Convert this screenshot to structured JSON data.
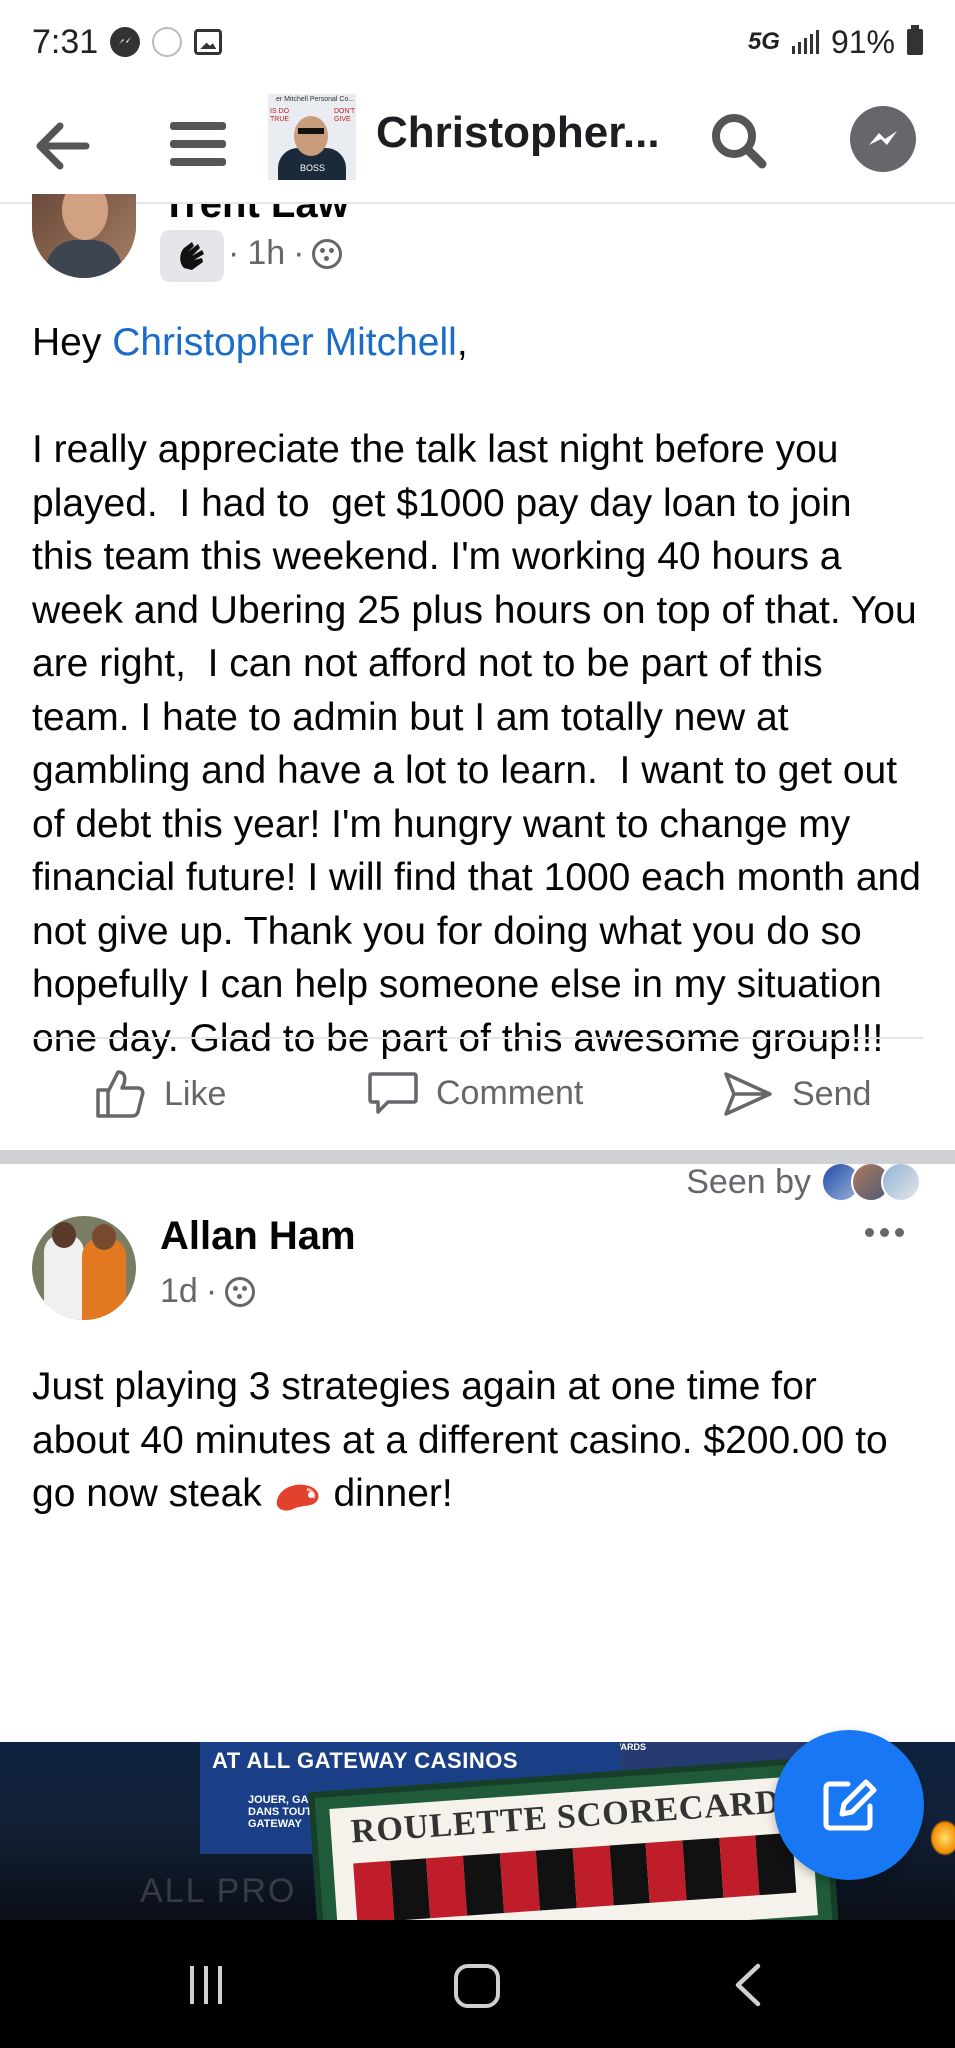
{
  "status_bar": {
    "time": "7:31",
    "network": "5G",
    "battery": "91%"
  },
  "header": {
    "group_name": "Christopher...",
    "thumb_caption_top": "er Mitchell Personal Co...",
    "thumb_left": "IS DO\nTRUE",
    "thumb_right": "DON'T\nGIVE",
    "thumb_shirt": "BOSS"
  },
  "post1": {
    "author_partial": "Trent Law",
    "time": "1h",
    "greeting_prefix": "Hey ",
    "mention": "Christopher Mitchell",
    "greeting_suffix": ",",
    "body": "I really appreciate the talk last night before you played.  I had to  get $1000 pay day loan to join this team this weekend. I'm working 40 hours a week and Ubering 25 plus hours on top of that. You are right,  I can not afford not to be part of this team. I hate to admin but I am totally new at gambling and have a lot to learn.  I want to get out of debt this year! I'm hungry want to change my financial future! I will find that 1000 each month and not give up. Thank you for doing what you do so hopefully I can help someone else in my situation one day. Glad to be part of this awesome group!!!",
    "seen_by_label": "Seen by",
    "actions": {
      "like": "Like",
      "comment": "Comment",
      "send": "Send"
    }
  },
  "post2": {
    "author": "Allan Ham",
    "time": "1d",
    "body_before_emoji": "Just playing 3 strategies again at one time for about 40 minutes at a different casino. $200.00 to go now steak ",
    "body_after_emoji": " dinner!",
    "photo": {
      "sign_text": "AT ALL GATEWAY CASINOS",
      "sign_subtext": "JOUER, GAGNER ET RÉCLAMER\nDANS TOUTES LES\nGATEWAY",
      "rewards_text": "REWARDS",
      "board_title": "ROULETTE SCORECARD",
      "background_text": "ALL PRO"
    }
  },
  "colors": {
    "accent": "#1877f2",
    "mention": "#1b6bc9",
    "secondary_text": "#65676b",
    "divider": "#e4e6eb",
    "separator": "#cfd1d5"
  },
  "icons": {
    "back": "arrow-left-icon",
    "menu": "hamburger-icon",
    "search": "search-icon",
    "messenger": "messenger-icon",
    "like": "thumbs-up-icon",
    "comment": "comment-bubble-icon",
    "send": "send-arrow-icon",
    "compose": "compose-pencil-icon",
    "privacy": "group-privacy-icon"
  }
}
